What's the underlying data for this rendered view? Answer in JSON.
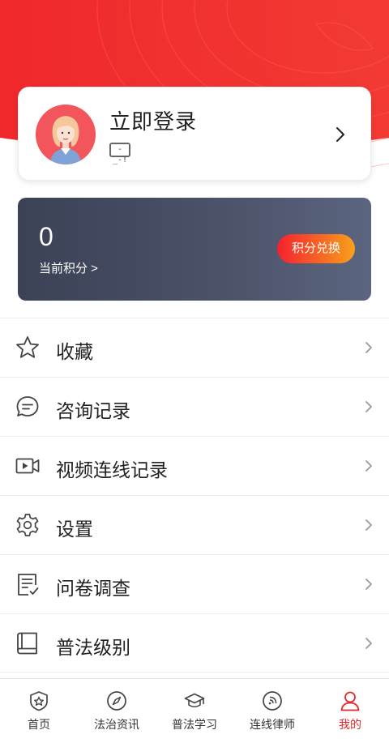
{
  "profile": {
    "login_label": "立即登录",
    "badge_text": "-_-!",
    "avatar_icon": "user-avatar-woman",
    "chevron_icon": "chevron-right-icon"
  },
  "points": {
    "value": "0",
    "label": "当前积分 >",
    "redeem_label": "积分兑换"
  },
  "menu": {
    "items": [
      {
        "label": "收藏",
        "icon": "star-icon"
      },
      {
        "label": "咨询记录",
        "icon": "chat-icon"
      },
      {
        "label": "视频连线记录",
        "icon": "video-icon"
      },
      {
        "label": "设置",
        "icon": "gear-icon"
      },
      {
        "label": "问卷调查",
        "icon": "survey-icon"
      },
      {
        "label": "普法级别",
        "icon": "book-icon"
      }
    ]
  },
  "tabbar": {
    "tabs": [
      {
        "label": "首页",
        "icon": "home-star-icon"
      },
      {
        "label": "法治资讯",
        "icon": "compass-icon"
      },
      {
        "label": "普法学习",
        "icon": "graduation-cap-icon"
      },
      {
        "label": "连线律师",
        "icon": "call-lawyer-icon"
      },
      {
        "label": "我的",
        "icon": "person-icon"
      }
    ],
    "active_index": 4
  },
  "colors": {
    "brand_red": "#e9242b",
    "points_card_start": "#3b4256",
    "points_card_end": "#5c6580"
  }
}
